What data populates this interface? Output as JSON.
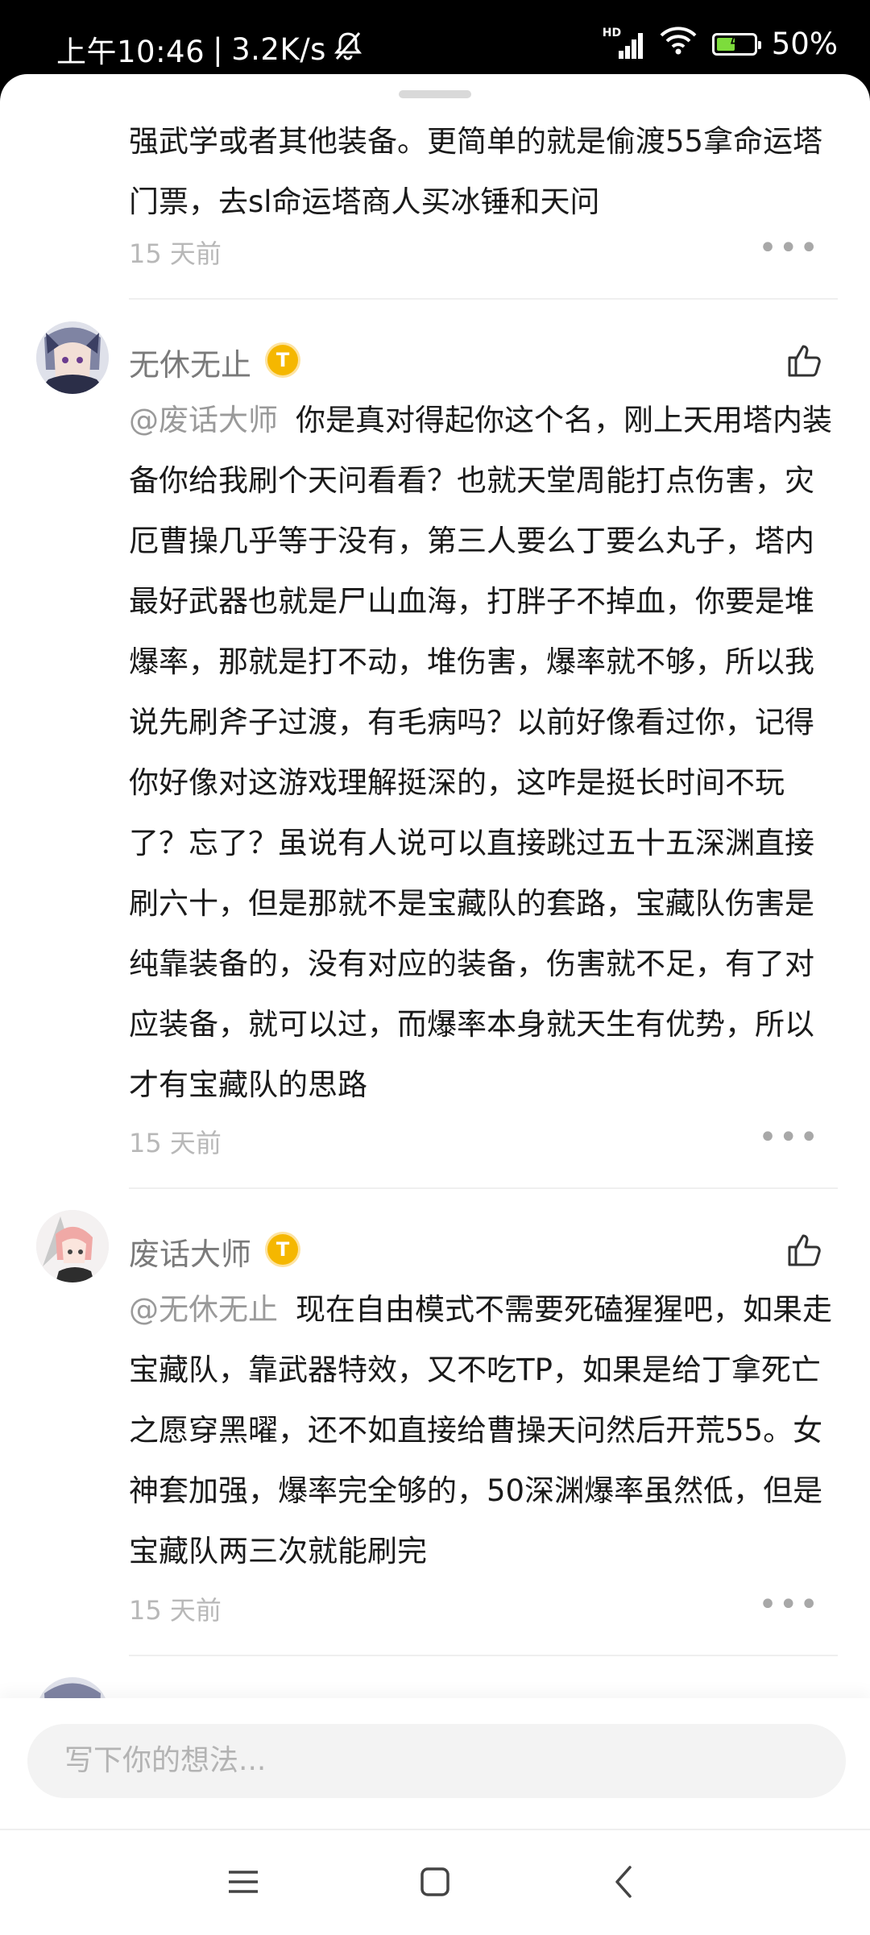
{
  "status_bar": {
    "time": "上午10:46",
    "net_speed": "3.2K/s",
    "battery": "50%",
    "battery_level": 0.5,
    "signal_label": "HD"
  },
  "comments": [
    {
      "text": "强武学或者其他装备。更简单的就是偷渡55拿命运塔门票，去sl命运塔商人买冰锤和天问",
      "time": "15 天前"
    },
    {
      "user": "无休无止",
      "mention": "@废话大师",
      "text": "你是真对得起你这个名，刚上天用塔内装备你给我刷个天问看看？也就天堂周能打点伤害，灾厄曹操几乎等于没有，第三人要么丁要么丸子，塔内最好武器也就是尸山血海，打胖子不掉血，你要是堆爆率，那就是打不动，堆伤害，爆率就不够，所以我说先刷斧子过渡，有毛病吗？以前好像看过你，记得你好像对这游戏理解挺深的，这咋是挺长时间不玩了？忘了？虽说有人说可以直接跳过五十五深渊直接刷六十，但是那就不是宝藏队的套路，宝藏队伤害是纯靠装备的，没有对应的装备，伤害就不足，有了对应装备，就可以过，而爆率本身就天生有优势，所以才有宝藏队的思路",
      "time": "15 天前"
    },
    {
      "user": "废话大师",
      "mention": "@无休无止",
      "text": "现在自由模式不需要死磕猩猩吧，如果走宝藏队，靠武器特效，又不吃TP，如果是给丁拿死亡之愿穿黑曜，还不如直接给曹操天问然后开荒55。女神套加强，爆率完全够的，50深渊爆率虽然低，但是宝藏队两三次就能刷完",
      "time": "15 天前"
    }
  ],
  "badge_letter": "T",
  "more_label": "•••",
  "composer": {
    "placeholder": "写下你的想法..."
  },
  "colors": {
    "badge": "#f5b700",
    "mention": "#9a9a9a",
    "meta": "#b8b8b8"
  },
  "icons": [
    "mute-icon",
    "signal-icon",
    "wifi-icon",
    "battery-icon",
    "thumb-up-icon",
    "more-icon",
    "menu-icon",
    "home-icon",
    "back-icon"
  ]
}
